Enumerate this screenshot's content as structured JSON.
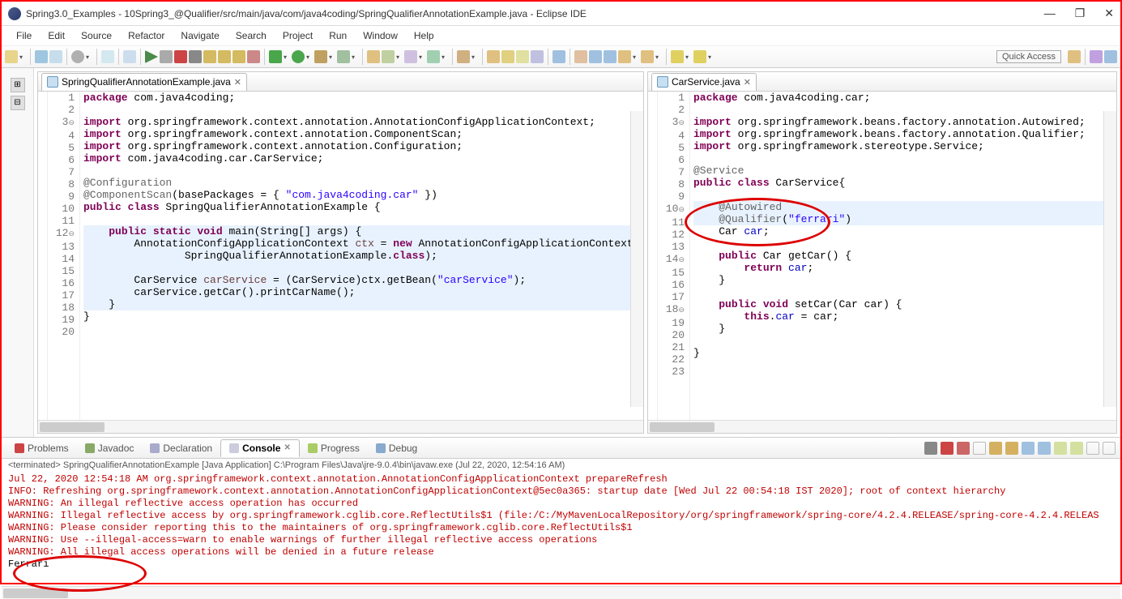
{
  "window": {
    "title": "Spring3.0_Examples - 10Spring3_@Qualifier/src/main/java/com/java4coding/SpringQualifierAnnotationExample.java - Eclipse IDE",
    "minimize": "—",
    "maximize": "❐",
    "close": "✕"
  },
  "menu": [
    "File",
    "Edit",
    "Source",
    "Refactor",
    "Navigate",
    "Search",
    "Project",
    "Run",
    "Window",
    "Help"
  ],
  "quick_access": "Quick Access",
  "editor_left": {
    "tab_label": "SpringQualifierAnnotationExample.java",
    "lines": [
      {
        "n": 1,
        "html": "<span class='kw'>package</span> com.java4coding;"
      },
      {
        "n": 2,
        "html": ""
      },
      {
        "n": 3,
        "fold": "⊖",
        "html": "<span class='kw'>import</span> org.springframework.context.annotation.AnnotationConfigApplicationContext;"
      },
      {
        "n": 4,
        "html": "<span class='kw'>import</span> org.springframework.context.annotation.ComponentScan;"
      },
      {
        "n": 5,
        "html": "<span class='kw'>import</span> org.springframework.context.annotation.Configuration;"
      },
      {
        "n": 6,
        "html": "<span class='kw'>import</span> com.java4coding.car.CarService;"
      },
      {
        "n": 7,
        "html": ""
      },
      {
        "n": 8,
        "html": "<span class='ann'>@Configuration</span>"
      },
      {
        "n": 9,
        "html": "<span class='ann'>@ComponentScan</span>(basePackages = { <span class='str'>\"com.java4coding.car\"</span> })"
      },
      {
        "n": 10,
        "html": "<span class='kw'>public class</span> SpringQualifierAnnotationExample {"
      },
      {
        "n": 11,
        "html": ""
      },
      {
        "n": 12,
        "fold": "⊖",
        "hl": true,
        "html": "    <span class='kw'>public static void</span> main(String[] args) {"
      },
      {
        "n": 13,
        "hl": true,
        "html": "        AnnotationConfigApplicationContext <span style='color:#6a3e3e'>ctx</span> = <span class='kw'>new</span> AnnotationConfigApplicationContext("
      },
      {
        "n": 14,
        "hl": true,
        "html": "                SpringQualifierAnnotationExample.<span class='kw'>class</span>);"
      },
      {
        "n": 15,
        "hl": true,
        "html": ""
      },
      {
        "n": 16,
        "hl": true,
        "html": "        CarService <span style='color:#6a3e3e'>carService</span> = (CarService)ctx.getBean(<span class='str'>\"carService\"</span>);"
      },
      {
        "n": 17,
        "hl": true,
        "html": "        carService.getCar().printCarName();"
      },
      {
        "n": 18,
        "hl": true,
        "html": "    }"
      },
      {
        "n": 19,
        "html": "}"
      },
      {
        "n": 20,
        "html": ""
      }
    ]
  },
  "editor_right": {
    "tab_label": "CarService.java",
    "lines": [
      {
        "n": 1,
        "html": "<span class='kw'>package</span> com.java4coding.car;"
      },
      {
        "n": 2,
        "html": ""
      },
      {
        "n": 3,
        "fold": "⊖",
        "html": "<span class='kw'>import</span> org.springframework.beans.factory.annotation.Autowired;"
      },
      {
        "n": 4,
        "html": "<span class='kw'>import</span> org.springframework.beans.factory.annotation.Qualifier;"
      },
      {
        "n": 5,
        "html": "<span class='kw'>import</span> org.springframework.stereotype.Service;"
      },
      {
        "n": 6,
        "html": ""
      },
      {
        "n": 7,
        "html": "<span class='ann'>@Service</span>"
      },
      {
        "n": 8,
        "html": "<span class='kw'>public class</span> CarService{"
      },
      {
        "n": 9,
        "html": ""
      },
      {
        "n": 10,
        "fold": "⊖",
        "hl": true,
        "html": "    <span class='ann'>@Autowired</span>"
      },
      {
        "n": 11,
        "hl": true,
        "html": "    <span class='ann'>@Qualifier</span>(<span class='str'>\"ferrari\"</span>)"
      },
      {
        "n": 12,
        "html": "    Car <span style='color:#0000c0'>car</span>;"
      },
      {
        "n": 13,
        "html": ""
      },
      {
        "n": 14,
        "fold": "⊖",
        "html": "    <span class='kw'>public</span> Car getCar() {"
      },
      {
        "n": 15,
        "html": "        <span class='kw'>return</span> <span style='color:#0000c0'>car</span>;"
      },
      {
        "n": 16,
        "html": "    }"
      },
      {
        "n": 17,
        "html": ""
      },
      {
        "n": 18,
        "fold": "⊖",
        "html": "    <span class='kw'>public void</span> setCar(Car car) {"
      },
      {
        "n": 19,
        "html": "        <span class='kw'>this</span>.<span style='color:#0000c0'>car</span> = car;"
      },
      {
        "n": 20,
        "html": "    }"
      },
      {
        "n": 21,
        "html": ""
      },
      {
        "n": 22,
        "html": "}"
      },
      {
        "n": 23,
        "html": ""
      }
    ]
  },
  "bottom_tabs": {
    "problems": "Problems",
    "javadoc": "Javadoc",
    "declaration": "Declaration",
    "console": "Console",
    "progress": "Progress",
    "debug": "Debug"
  },
  "console": {
    "status": "<terminated> SpringQualifierAnnotationExample [Java Application] C:\\Program Files\\Java\\jre-9.0.4\\bin\\javaw.exe (Jul 22, 2020, 12:54:16 AM)",
    "lines": [
      {
        "cls": "red",
        "text": "Jul 22, 2020 12:54:18 AM org.springframework.context.annotation.AnnotationConfigApplicationContext prepareRefresh"
      },
      {
        "cls": "red",
        "text": "INFO: Refreshing org.springframework.context.annotation.AnnotationConfigApplicationContext@5ec0a365: startup date [Wed Jul 22 00:54:18 IST 2020]; root of context hierarchy"
      },
      {
        "cls": "red",
        "text": "WARNING: An illegal reflective access operation has occurred"
      },
      {
        "cls": "red",
        "text": "WARNING: Illegal reflective access by org.springframework.cglib.core.ReflectUtils$1 (file:/C:/MyMavenLocalRepository/org/springframework/spring-core/4.2.4.RELEASE/spring-core-4.2.4.RELEAS"
      },
      {
        "cls": "red",
        "text": "WARNING: Please consider reporting this to the maintainers of org.springframework.cglib.core.ReflectUtils$1"
      },
      {
        "cls": "red",
        "text": "WARNING: Use --illegal-access=warn to enable warnings of further illegal reflective access operations"
      },
      {
        "cls": "red",
        "text": "WARNING: All illegal access operations will be denied in a future release"
      },
      {
        "cls": "",
        "text": "Ferrari"
      }
    ]
  }
}
